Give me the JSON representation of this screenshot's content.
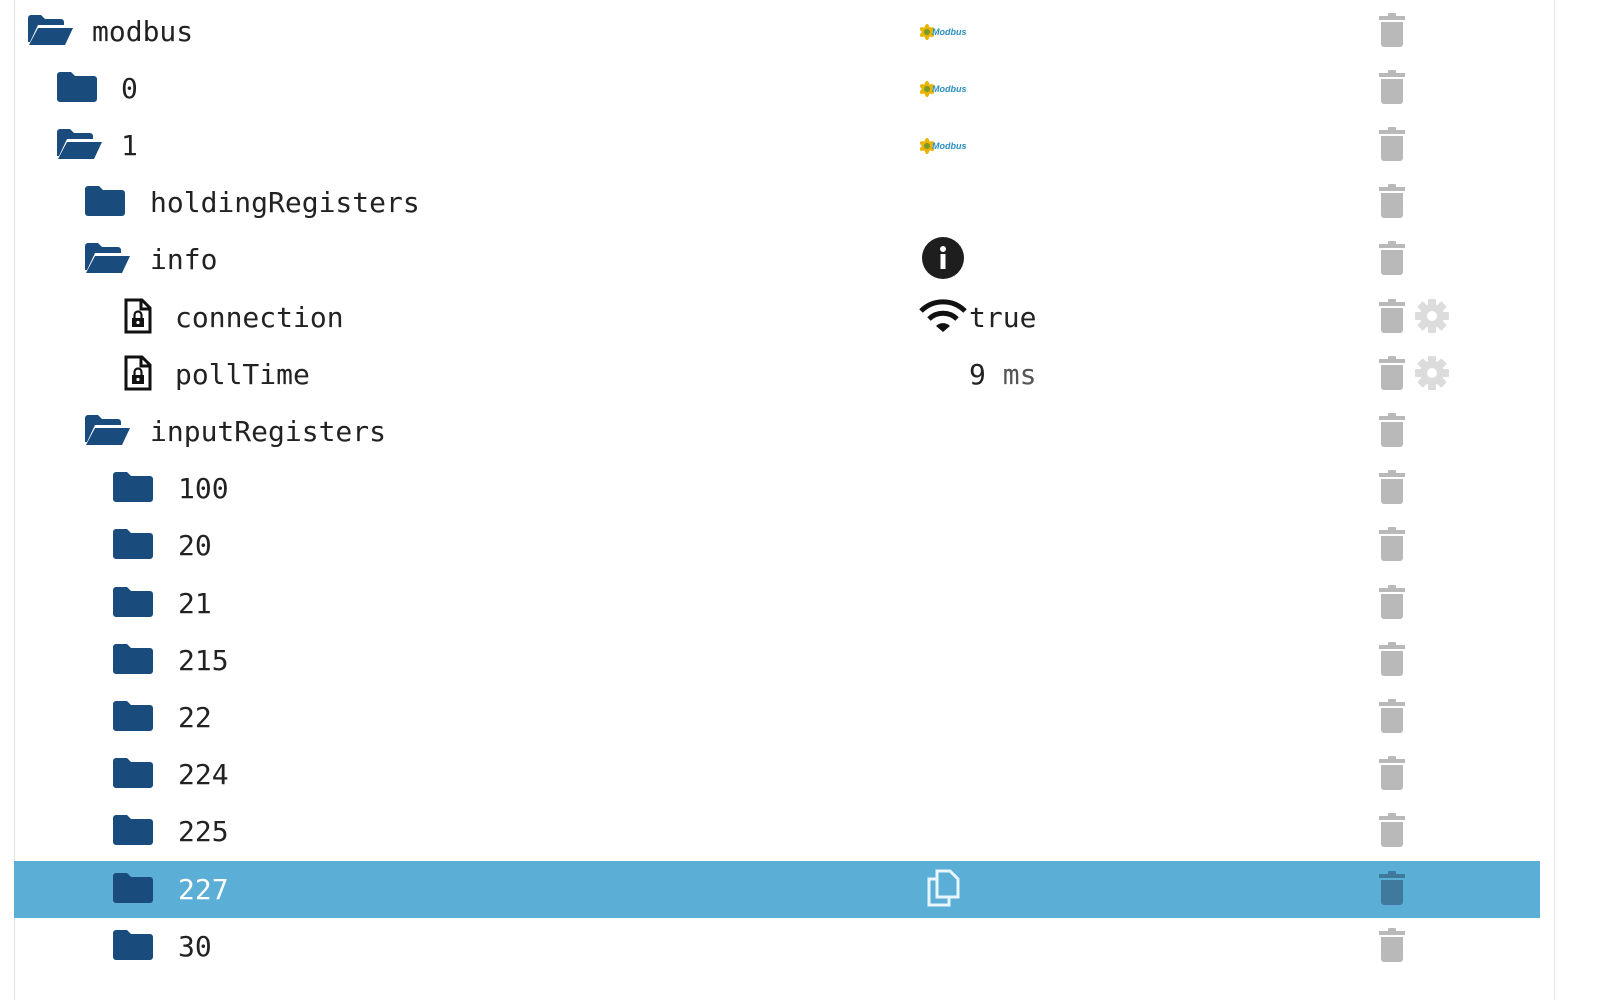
{
  "colors": {
    "folder": "#1a4b7d",
    "selected_row": "#5baed6",
    "trash": "#b9b9b9",
    "trash_selected": "#3f7a9c",
    "gear": "#dcdcdc"
  },
  "tree": [
    {
      "label": "modbus",
      "level": 0,
      "type": "folder-open",
      "badge": "modbus-logo",
      "logo_text": "Modbus"
    },
    {
      "label": "0",
      "level": 1,
      "type": "folder",
      "badge": "modbus-logo",
      "logo_text": "Modbus"
    },
    {
      "label": "1",
      "level": 1,
      "type": "folder-open",
      "badge": "modbus-logo",
      "logo_text": "Modbus"
    },
    {
      "label": "holdingRegisters",
      "level": 2,
      "type": "folder"
    },
    {
      "label": "info",
      "level": 2,
      "type": "folder-open",
      "badge": "info-icon"
    },
    {
      "label": "connection",
      "level": 3,
      "type": "state",
      "badge": "wifi-icon",
      "value": "true",
      "settings": true
    },
    {
      "label": "pollTime",
      "level": 3,
      "type": "state",
      "value": "9",
      "unit": "ms",
      "settings": true
    },
    {
      "label": "inputRegisters",
      "level": 2,
      "type": "folder-open"
    },
    {
      "label": "100",
      "level": 3,
      "type": "folder"
    },
    {
      "label": "20",
      "level": 3,
      "type": "folder"
    },
    {
      "label": "21",
      "level": 3,
      "type": "folder"
    },
    {
      "label": "215",
      "level": 3,
      "type": "folder"
    },
    {
      "label": "22",
      "level": 3,
      "type": "folder"
    },
    {
      "label": "224",
      "level": 3,
      "type": "folder"
    },
    {
      "label": "225",
      "level": 3,
      "type": "folder"
    },
    {
      "label": "227",
      "level": 3,
      "type": "folder",
      "selected": true,
      "badge": "copy-icon"
    },
    {
      "label": "30",
      "level": 3,
      "type": "folder"
    }
  ]
}
